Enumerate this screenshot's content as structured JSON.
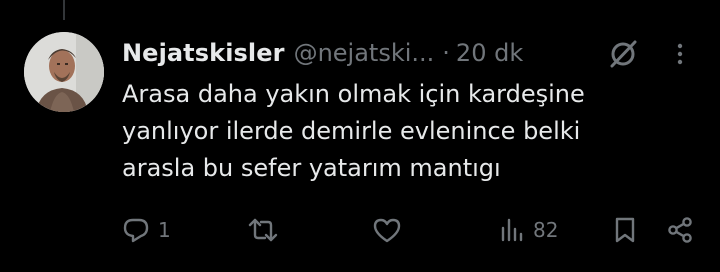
{
  "tweet": {
    "display_name": "Nejatskisler",
    "handle": "@nejatski...",
    "separator": "·",
    "time": "20 dk",
    "text": "Arasa daha yakın olmak için kardeşine\nyanlıyor ilerde demirle evlenince belki\narasla bu sefer yatarım mantıgı"
  },
  "actions": {
    "reply_count": "1",
    "views_count": "82"
  },
  "icons": {
    "grok": "grok-icon",
    "more": "more-icon",
    "reply": "reply-icon",
    "retweet": "retweet-icon",
    "like": "heart-icon",
    "views": "views-icon",
    "bookmark": "bookmark-icon",
    "share": "share-icon"
  },
  "colors": {
    "background": "#000000",
    "primary_text": "#e7e9ea",
    "secondary_text": "#71767b",
    "thread_line": "#333639"
  }
}
